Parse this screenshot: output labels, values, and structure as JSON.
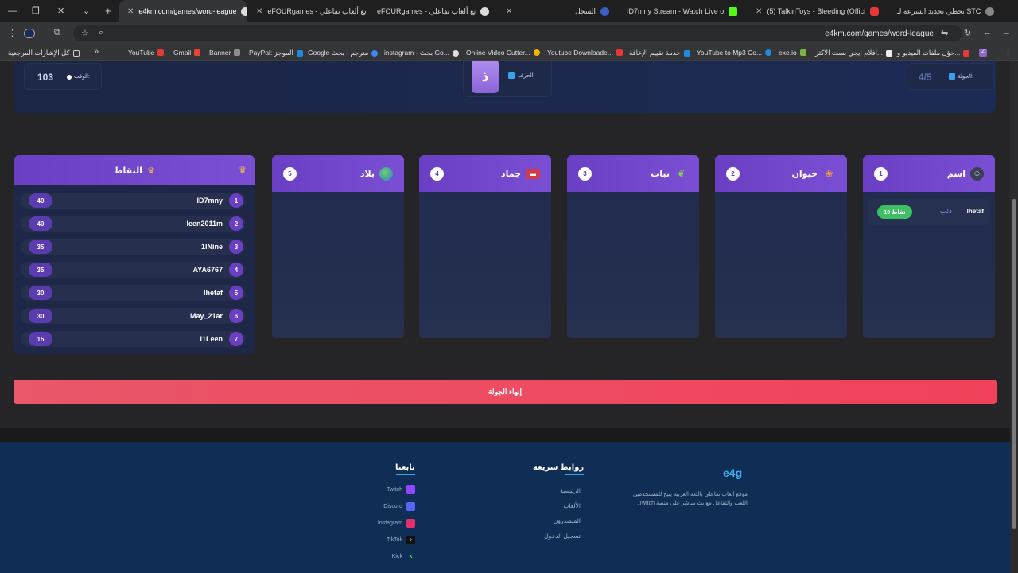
{
  "tabs": [
    {
      "title": "e4km.com/games/word-league",
      "active": true
    },
    {
      "title": "eFOURgames - تع ألعاب تفاعلي",
      "active": false
    },
    {
      "title": "eFOURgames - تع ألعاب تفاعلي",
      "active": false
    },
    {
      "title": "السجل",
      "active": false
    },
    {
      "title": "ID7mny Stream - Watch Live o",
      "active": false
    },
    {
      "title": "(5) TalkinToys - Bleeding (Offici",
      "active": false
    },
    {
      "title": "تحطي تحديد السرعة لـ STC",
      "active": false
    }
  ],
  "address": {
    "url": "e4km.com/games/word-league"
  },
  "bookmarks": [
    {
      "label": "كل الإشارات المرجعية",
      "color": "#d9a441"
    },
    {
      "label": "YouTube",
      "color": "#e53935"
    },
    {
      "label": "Gmail",
      "color": "#ea4335"
    },
    {
      "label": "Banner",
      "color": "#8e8e8e"
    },
    {
      "label": "PayPal: الموجز",
      "color": "#1e88e5"
    },
    {
      "label": "Google مترجم - بحث",
      "color": "#4285f4"
    },
    {
      "label": "instagram - بحث Go...",
      "color": "#8e8e8e"
    },
    {
      "label": "Online Video Cutter...",
      "color": "#f4b400"
    },
    {
      "label": "Youtube Downloade...",
      "color": "#e53935"
    },
    {
      "label": "خدمة تقييم الإعاقة",
      "color": "#1e88e5"
    },
    {
      "label": "YouTube to Mp3 Co...",
      "color": "#1e88e5"
    },
    {
      "label": "exe.io",
      "color": "#7cb342"
    },
    {
      "label": "افلام ايجي بست الاكثر...",
      "color": "#eeeeee"
    },
    {
      "label": "حؤل ملفات الفيديو و...",
      "color": "#e53935"
    },
    {
      "label": "2",
      "color": "#8e63ce"
    }
  ],
  "game": {
    "timer_label": "الوقت:",
    "timer_value": "103",
    "letter_label": "الحرف:",
    "letter": "ذ",
    "round_label": "الجولة:",
    "round_value": "4/5",
    "end_round_label": "إنهاء الجولة"
  },
  "columns": [
    {
      "title": "اسم",
      "number": "1",
      "icon": "person-icon",
      "entries": [
        {
          "player": "lhetaf",
          "word": "ذئب",
          "points": "10 نقاط"
        }
      ]
    },
    {
      "title": "حيوان",
      "number": "2",
      "icon": "paw-icon",
      "entries": []
    },
    {
      "title": "نبات",
      "number": "3",
      "icon": "leaf-icon",
      "entries": []
    },
    {
      "title": "جماد",
      "number": "4",
      "icon": "toolbox-icon",
      "entries": []
    },
    {
      "title": "بلاد",
      "number": "5",
      "icon": "globe-icon",
      "entries": []
    }
  ],
  "scoreboard": {
    "title": "النقاط",
    "players": [
      {
        "rank": "1",
        "name": "ID7mny",
        "points": "40"
      },
      {
        "rank": "2",
        "name": "leen2011m",
        "points": "40"
      },
      {
        "rank": "3",
        "name": "1lNine",
        "points": "35"
      },
      {
        "rank": "4",
        "name": "AYA6767",
        "points": "35"
      },
      {
        "rank": "5",
        "name": "lhetaf",
        "points": "30"
      },
      {
        "rank": "6",
        "name": "May_21ar",
        "points": "30"
      },
      {
        "rank": "7",
        "name": "l1Leen",
        "points": "15"
      }
    ]
  },
  "footer": {
    "brand": "e4g",
    "description": "موقع العاب تفاعلي باللغة العربية يتيح للمستخدمين اللعب والتفاعل مع بث مباشر على منصة Twitch.",
    "quick_links_title": "روابط سريعة",
    "quick_links": [
      "الرئيسية",
      "الألعاب",
      "المتصدرون",
      "تسجيل الدخول"
    ],
    "follow_title": "تابعنا",
    "socials": [
      {
        "name": "Twitch",
        "icon": "twitch-icon",
        "color": "#9146ff"
      },
      {
        "name": "Discord",
        "icon": "discord-icon",
        "color": "#5865f2"
      },
      {
        "name": "Instagram",
        "icon": "instagram-icon",
        "color": "#e1306c"
      },
      {
        "name": "TikTok",
        "icon": "tiktok-icon",
        "color": "#111111"
      },
      {
        "name": "Kick",
        "icon": "kick-icon",
        "color": "#53fc18"
      }
    ]
  }
}
